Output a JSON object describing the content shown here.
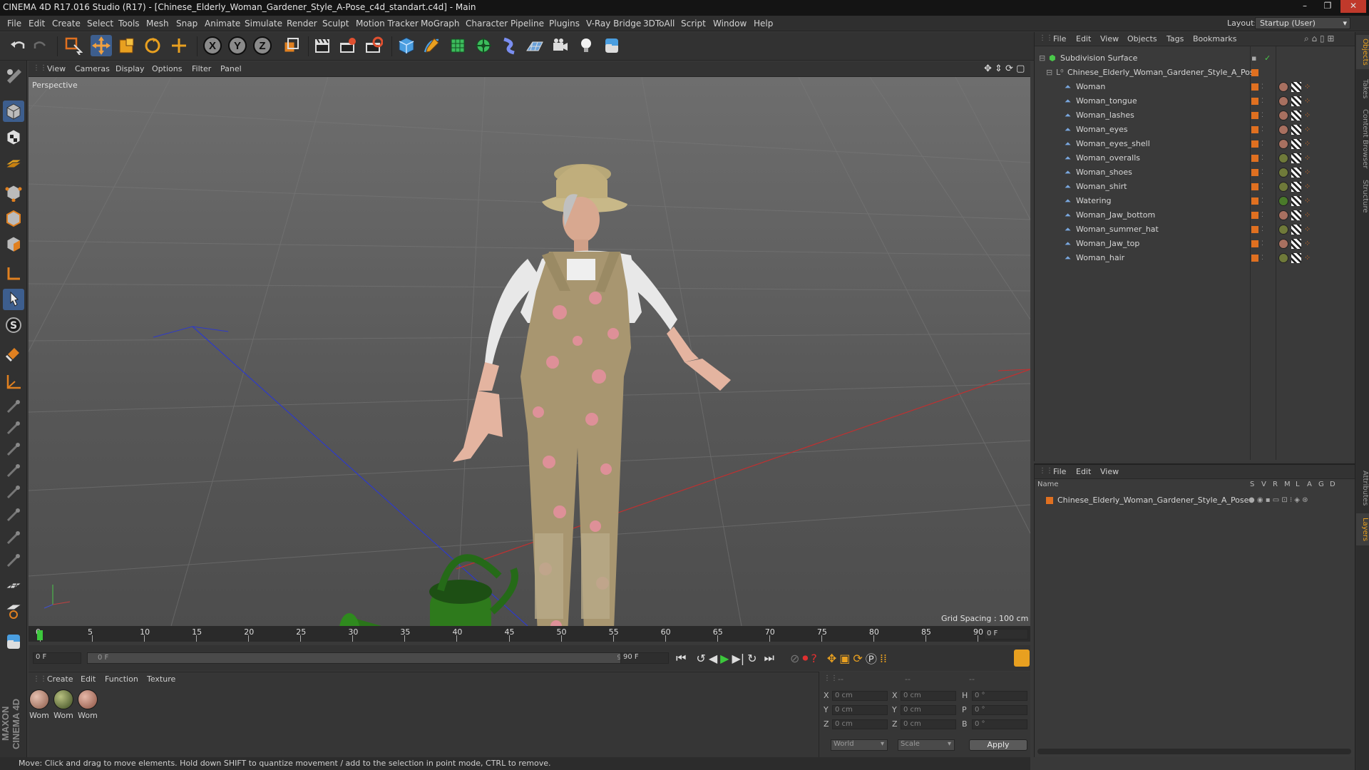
{
  "title": "CINEMA 4D R17.016 Studio (R17) - [Chinese_Elderly_Woman_Gardener_Style_A-Pose_c4d_standart.c4d] - Main",
  "window_controls": [
    "–",
    "❐",
    "✕"
  ],
  "menu": [
    "File",
    "Edit",
    "Create",
    "Select",
    "Tools",
    "Mesh",
    "Snap",
    "Animate",
    "Simulate",
    "Render",
    "Sculpt",
    "Motion Tracker",
    "MoGraph",
    "Character",
    "Pipeline",
    "Plugins",
    "V-Ray Bridge",
    "3DToAll",
    "Script",
    "Window",
    "Help"
  ],
  "layout": {
    "label": "Layout:",
    "value": "Startup (User)"
  },
  "viewport": {
    "menu": [
      "View",
      "Cameras",
      "Display",
      "Options",
      "Filter",
      "Panel"
    ],
    "label": "Perspective",
    "grid_spacing": "Grid Spacing : 100 cm"
  },
  "timeline": {
    "ticks": [
      "0",
      "5",
      "10",
      "15",
      "20",
      "25",
      "30",
      "35",
      "40",
      "45",
      "50",
      "55",
      "60",
      "65",
      "70",
      "75",
      "80",
      "85",
      "90"
    ],
    "current_frame": "0 F",
    "start_field": "0 F",
    "range_start": "0 F",
    "range_end": "90 F",
    "end_field": "90 F"
  },
  "materials": {
    "menu": [
      "Create",
      "Edit",
      "Function",
      "Texture"
    ],
    "items": [
      {
        "label": "Wom",
        "color": "#b08070"
      },
      {
        "label": "Wom",
        "color": "#6a7a40"
      },
      {
        "label": "Wom",
        "color": "#b07868"
      }
    ]
  },
  "coords": {
    "header": [
      "--",
      "--",
      "--"
    ],
    "rows": [
      {
        "a": "X",
        "av": "0 cm",
        "b": "X",
        "bv": "0 cm",
        "c": "H",
        "cv": "0 °"
      },
      {
        "a": "Y",
        "av": "0 cm",
        "b": "Y",
        "bv": "0 cm",
        "c": "P",
        "cv": "0 °"
      },
      {
        "a": "Z",
        "av": "0 cm",
        "b": "Z",
        "bv": "0 cm",
        "c": "B",
        "cv": "0 °"
      }
    ],
    "world": "World",
    "scale": "Scale",
    "apply": "Apply"
  },
  "status": "Move: Click and drag to move elements. Hold down SHIFT to quantize movement / add to the selection in point mode, CTRL to remove.",
  "objects_panel": {
    "menu": [
      "File",
      "Edit",
      "View",
      "Objects",
      "Tags",
      "Bookmarks"
    ],
    "root": "Subdivision Surface",
    "group": "Chinese_Elderly_Woman_Gardener_Style_A_Pose",
    "items": [
      "Woman",
      "Woman_tongue",
      "Woman_lashes",
      "Woman_eyes",
      "Woman_eyes_shell",
      "Woman_overalls",
      "Woman_shoes",
      "Woman_shirt",
      "Watering",
      "Woman_Jaw_bottom",
      "Woman_summer_hat",
      "Woman_Jaw_top",
      "Woman_hair"
    ],
    "tag_colors": [
      "#a87060",
      "#a87060",
      "#a87060",
      "#a87060",
      "#a87060",
      "#6f7a3a",
      "#6f7a3a",
      "#6f7a3a",
      "#4a7a2a",
      "#a87060",
      "#6f7a3a",
      "#a87060",
      "#6f7a3a"
    ]
  },
  "layers_panel": {
    "menu": [
      "File",
      "Edit",
      "View"
    ],
    "columns": [
      "Name",
      "S",
      "V",
      "R",
      "M",
      "L",
      "A",
      "G",
      "D"
    ],
    "rows": [
      "Chinese_Elderly_Woman_Gardener_Style_A_Pose"
    ]
  },
  "side_tabs": [
    "Objects",
    "Takes",
    "Content Browser",
    "Structure",
    "Attributes",
    "Layers"
  ],
  "maxon_logo": "MAXON CINEMA 4D",
  "colors": {
    "accent": "#e07020",
    "selection": "#3b6fb6",
    "active_play": "#3c9c3c"
  }
}
